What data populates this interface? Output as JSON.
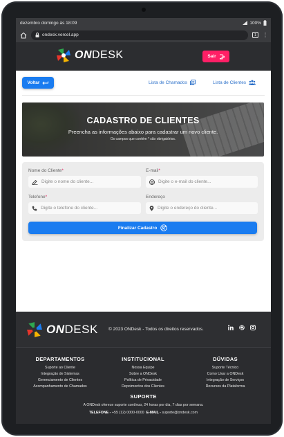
{
  "status_bar": {
    "time": "dezembro domingo às 18:09",
    "battery": "100%"
  },
  "browser": {
    "url": "ondesk.vercel.app",
    "tab_count": "1"
  },
  "header": {
    "logo_on": "ON",
    "logo_desk": "DESK",
    "logout_label": "Sair"
  },
  "nav": {
    "back_label": "Voltar",
    "tickets_link": "Lista de Chamados",
    "clients_link": "Lista de Clientes"
  },
  "hero": {
    "title": "CADASTRO DE CLIENTES",
    "subtitle": "Preencha as informações abaixo para cadastrar um novo cliente.",
    "note": "Os campos que contém * são obrigatórios."
  },
  "form": {
    "name": {
      "label": "Nome do Cliente",
      "required_mark": "*",
      "placeholder": "Digite o nome do cliente..."
    },
    "email": {
      "label": "E-mail",
      "required_mark": "*",
      "placeholder": "Digite o e-mail do cliente..."
    },
    "phone": {
      "label": "Telefone",
      "required_mark": "*",
      "placeholder": "Digite o telefone do cliente..."
    },
    "address": {
      "label": "Endereço",
      "placeholder": "Digite o endereço do cliente..."
    },
    "submit_label": "Finalizar Cadastro"
  },
  "footer": {
    "logo_on": "ON",
    "logo_desk": "DESK",
    "copyright": "© 2023 ONDesk - Todos os direitos reservados.",
    "columns": [
      {
        "title": "DEPARTAMENTOS",
        "items": [
          "Suporte ao Cliente",
          "Integração de Sistemas",
          "Gerenciamento de Clientes",
          "Acompanhamento de Chamados"
        ]
      },
      {
        "title": "INSTITUCIONAL",
        "items": [
          "Nossa Equipe",
          "Sobre a ONDesk",
          "Política de Privacidade",
          "Depoimentos dos Clientes"
        ]
      },
      {
        "title": "DÚVIDAS",
        "items": [
          "Suporte Técnico",
          "Como Usar a ONDesk",
          "Integração de Serviços",
          "Recursos da Plataforma"
        ]
      }
    ],
    "support_title": "SUPORTE",
    "support_text": "A ONDesk oferece suporte contínuo, 24 horas por dia, 7 dias por semana.",
    "phone_label": "TELEFONE -",
    "phone_value": "+55 (12) 0000-0000",
    "email_label": "E-MAIL -",
    "email_value": "suporte@ondesk.com"
  },
  "colors": {
    "accent": "#1a7cf0",
    "logout": "#ff1f66",
    "header_bg": "#2c2d30",
    "footer_bg": "#2b2c2f"
  },
  "icons": [
    "home-icon",
    "lock-icon",
    "tab-count-icon",
    "menu-icon",
    "ondesk-logo-icon",
    "logout-icon",
    "back-arrow-icon",
    "ticket-list-icon",
    "clients-icon",
    "pen-icon",
    "at-icon",
    "phone-icon",
    "location-icon",
    "add-user-icon",
    "linkedin-icon",
    "github-icon",
    "instagram-icon"
  ]
}
